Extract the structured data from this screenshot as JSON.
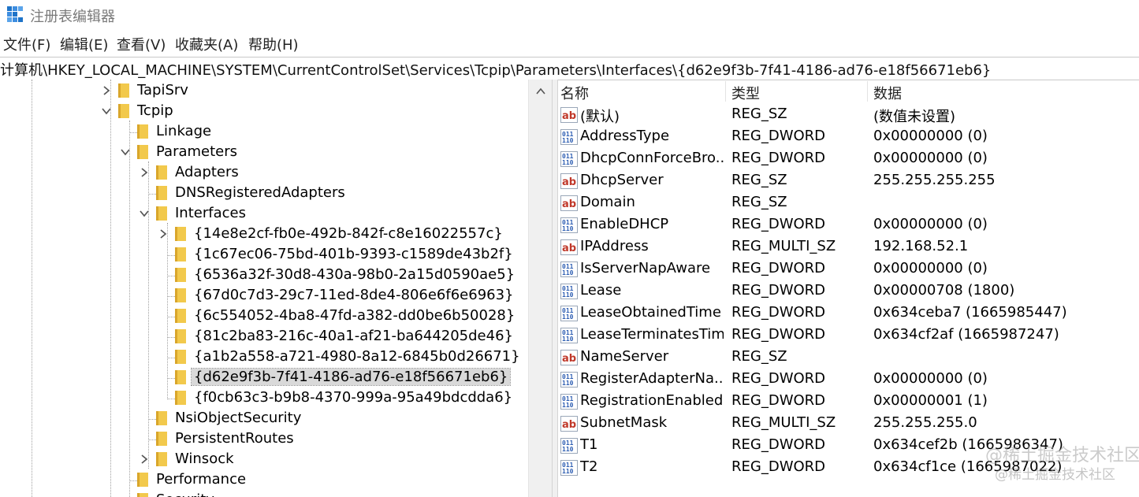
{
  "window": {
    "title": "注册表编辑器"
  },
  "menu": [
    "文件(F)",
    "编辑(E)",
    "查看(V)",
    "收藏夹(A)",
    "帮助(H)"
  ],
  "address": "计算机\\HKEY_LOCAL_MACHINE\\SYSTEM\\CurrentControlSet\\Services\\Tcpip\\Parameters\\Interfaces\\{d62e9f3b-7f41-4186-ad76-e18f56671eb6}",
  "tree": [
    {
      "label": "TapiSrv",
      "depth": 0,
      "expander": "collapsed"
    },
    {
      "label": "Tcpip",
      "depth": 0,
      "expander": "expanded"
    },
    {
      "label": "Linkage",
      "depth": 1,
      "expander": "none"
    },
    {
      "label": "Parameters",
      "depth": 1,
      "expander": "expanded"
    },
    {
      "label": "Adapters",
      "depth": 2,
      "expander": "collapsed"
    },
    {
      "label": "DNSRegisteredAdapters",
      "depth": 2,
      "expander": "none"
    },
    {
      "label": "Interfaces",
      "depth": 2,
      "expander": "expanded"
    },
    {
      "label": "{14e8e2cf-fb0e-492b-842f-c8e16022557c}",
      "depth": 3,
      "expander": "collapsed"
    },
    {
      "label": "{1c67ec06-75bd-401b-9393-c1589de43b2f}",
      "depth": 3,
      "expander": "none"
    },
    {
      "label": "{6536a32f-30d8-430a-98b0-2a15d0590ae5}",
      "depth": 3,
      "expander": "none"
    },
    {
      "label": "{67d0c7d3-29c7-11ed-8de4-806e6f6e6963}",
      "depth": 3,
      "expander": "none"
    },
    {
      "label": "{6c554052-4ba8-47fd-a382-dd0be6b50028}",
      "depth": 3,
      "expander": "none"
    },
    {
      "label": "{81c2ba83-216c-40a1-af21-ba644205de46}",
      "depth": 3,
      "expander": "none"
    },
    {
      "label": "{a1b2a558-a721-4980-8a12-6845b0d26671}",
      "depth": 3,
      "expander": "none"
    },
    {
      "label": "{d62e9f3b-7f41-4186-ad76-e18f56671eb6}",
      "depth": 3,
      "expander": "none",
      "selected": true
    },
    {
      "label": "{f0cb63c3-b9b8-4370-999a-95a49bdcdda6}",
      "depth": 3,
      "expander": "none"
    },
    {
      "label": "NsiObjectSecurity",
      "depth": 2,
      "expander": "none"
    },
    {
      "label": "PersistentRoutes",
      "depth": 2,
      "expander": "none"
    },
    {
      "label": "Winsock",
      "depth": 2,
      "expander": "collapsed"
    },
    {
      "label": "Performance",
      "depth": 1,
      "expander": "none"
    },
    {
      "label": "Security",
      "depth": 1,
      "expander": "none"
    }
  ],
  "columns": {
    "name": "名称",
    "type": "类型",
    "data": "数据"
  },
  "values": [
    {
      "icon": "ab",
      "name": "(默认)",
      "type": "REG_SZ",
      "data": "(数值未设置)"
    },
    {
      "icon": "bin",
      "name": "AddressType",
      "type": "REG_DWORD",
      "data": "0x00000000 (0)"
    },
    {
      "icon": "bin",
      "name": "DhcpConnForceBro...",
      "type": "REG_DWORD",
      "data": "0x00000000 (0)"
    },
    {
      "icon": "ab",
      "name": "DhcpServer",
      "type": "REG_SZ",
      "data": "255.255.255.255"
    },
    {
      "icon": "ab",
      "name": "Domain",
      "type": "REG_SZ",
      "data": ""
    },
    {
      "icon": "bin",
      "name": "EnableDHCP",
      "type": "REG_DWORD",
      "data": "0x00000000 (0)"
    },
    {
      "icon": "ab",
      "name": "IPAddress",
      "type": "REG_MULTI_SZ",
      "data": "192.168.52.1"
    },
    {
      "icon": "bin",
      "name": "IsServerNapAware",
      "type": "REG_DWORD",
      "data": "0x00000000 (0)"
    },
    {
      "icon": "bin",
      "name": "Lease",
      "type": "REG_DWORD",
      "data": "0x00000708 (1800)"
    },
    {
      "icon": "bin",
      "name": "LeaseObtainedTime",
      "type": "REG_DWORD",
      "data": "0x634ceba7 (1665985447)"
    },
    {
      "icon": "bin",
      "name": "LeaseTerminatesTime",
      "type": "REG_DWORD",
      "data": "0x634cf2af (1665987247)"
    },
    {
      "icon": "ab",
      "name": "NameServer",
      "type": "REG_SZ",
      "data": ""
    },
    {
      "icon": "bin",
      "name": "RegisterAdapterNa...",
      "type": "REG_DWORD",
      "data": "0x00000000 (0)"
    },
    {
      "icon": "bin",
      "name": "RegistrationEnabled",
      "type": "REG_DWORD",
      "data": "0x00000001 (1)"
    },
    {
      "icon": "ab",
      "name": "SubnetMask",
      "type": "REG_MULTI_SZ",
      "data": "255.255.255.0"
    },
    {
      "icon": "bin",
      "name": "T1",
      "type": "REG_DWORD",
      "data": "0x634cef2b (1665986347)"
    },
    {
      "icon": "bin",
      "name": "T2",
      "type": "REG_DWORD",
      "data": "0x634cf1ce (1665987022)"
    }
  ],
  "watermark": {
    "line1": "@稀土掘金技术社区",
    "line2": "@稀土掘金技术社区"
  },
  "colors": {
    "folder": "#f2c94c",
    "folder_dark": "#d9a62b",
    "ab_icon": "#c0392b",
    "bin_icon": "#2f5fb3",
    "selected_bg": "#d9d9d9"
  }
}
